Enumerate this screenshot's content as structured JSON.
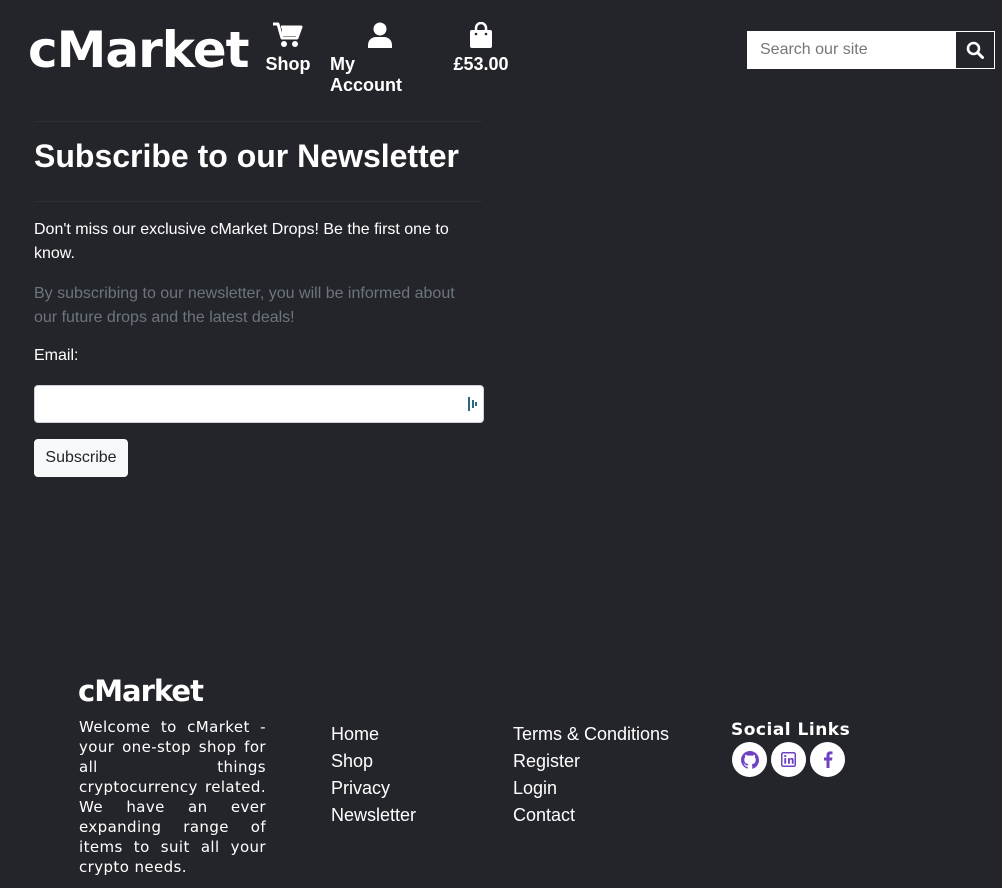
{
  "header": {
    "logo": "cMarket",
    "nav": [
      {
        "label": "Shop",
        "icon": "shopping-cart-icon"
      },
      {
        "label": "My Account",
        "icon": "user-icon"
      },
      {
        "label": "£53.00",
        "icon": "shopping-bag-icon"
      }
    ],
    "search": {
      "placeholder": "Search our site",
      "value": "",
      "button_icon": "search-icon"
    }
  },
  "newsletter": {
    "title": "Subscribe to our Newsletter",
    "lead": "Don't miss our exclusive cMarket Drops! Be the first one to know.",
    "description": "By subscribing to our newsletter, you will be informed about our future drops and the latest deals!",
    "email_label": "Email:",
    "email_value": "",
    "button_label": "Subscribe"
  },
  "footer": {
    "logo": "cMarket",
    "description": "Welcome to cMarket - your one-stop shop for all things cryptocurrency related. We have an ever expanding range of items to suit all your crypto needs.",
    "links_col1": [
      "Home",
      "Shop",
      "Privacy",
      "Newsletter"
    ],
    "links_col2": [
      "Terms & Conditions",
      "Register",
      "Login",
      "Contact"
    ],
    "social_title": "Social Links",
    "social": [
      {
        "icon": "github-icon"
      },
      {
        "icon": "linkedin-icon"
      },
      {
        "icon": "facebook-icon"
      }
    ]
  },
  "colors": {
    "background": "#24252b",
    "text": "#ffffff",
    "muted_text": "#6c757d",
    "social_icon": "#6f42c1",
    "button_bg": "#f8f9fa"
  }
}
